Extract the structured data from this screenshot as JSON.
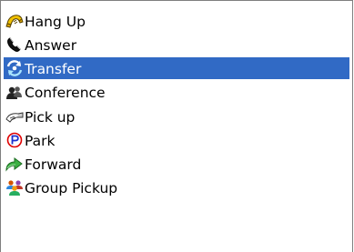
{
  "menu": {
    "items": [
      {
        "label": "Hang Up",
        "icon": "hang-up-icon",
        "selected": false
      },
      {
        "label": "Answer",
        "icon": "answer-phone-icon",
        "selected": false
      },
      {
        "label": "Transfer",
        "icon": "transfer-icon",
        "selected": true
      },
      {
        "label": "Conference",
        "icon": "conference-icon",
        "selected": false
      },
      {
        "label": "Pick up",
        "icon": "pick-up-icon",
        "selected": false
      },
      {
        "label": "Park",
        "icon": "park-icon",
        "selected": false
      },
      {
        "label": "Forward",
        "icon": "forward-icon",
        "selected": false
      },
      {
        "label": "Group Pickup",
        "icon": "group-pickup-icon",
        "selected": false
      }
    ]
  },
  "colors": {
    "selection_background": "#316ac5",
    "selection_text": "#ffffff",
    "border": "#7f7f7f"
  }
}
